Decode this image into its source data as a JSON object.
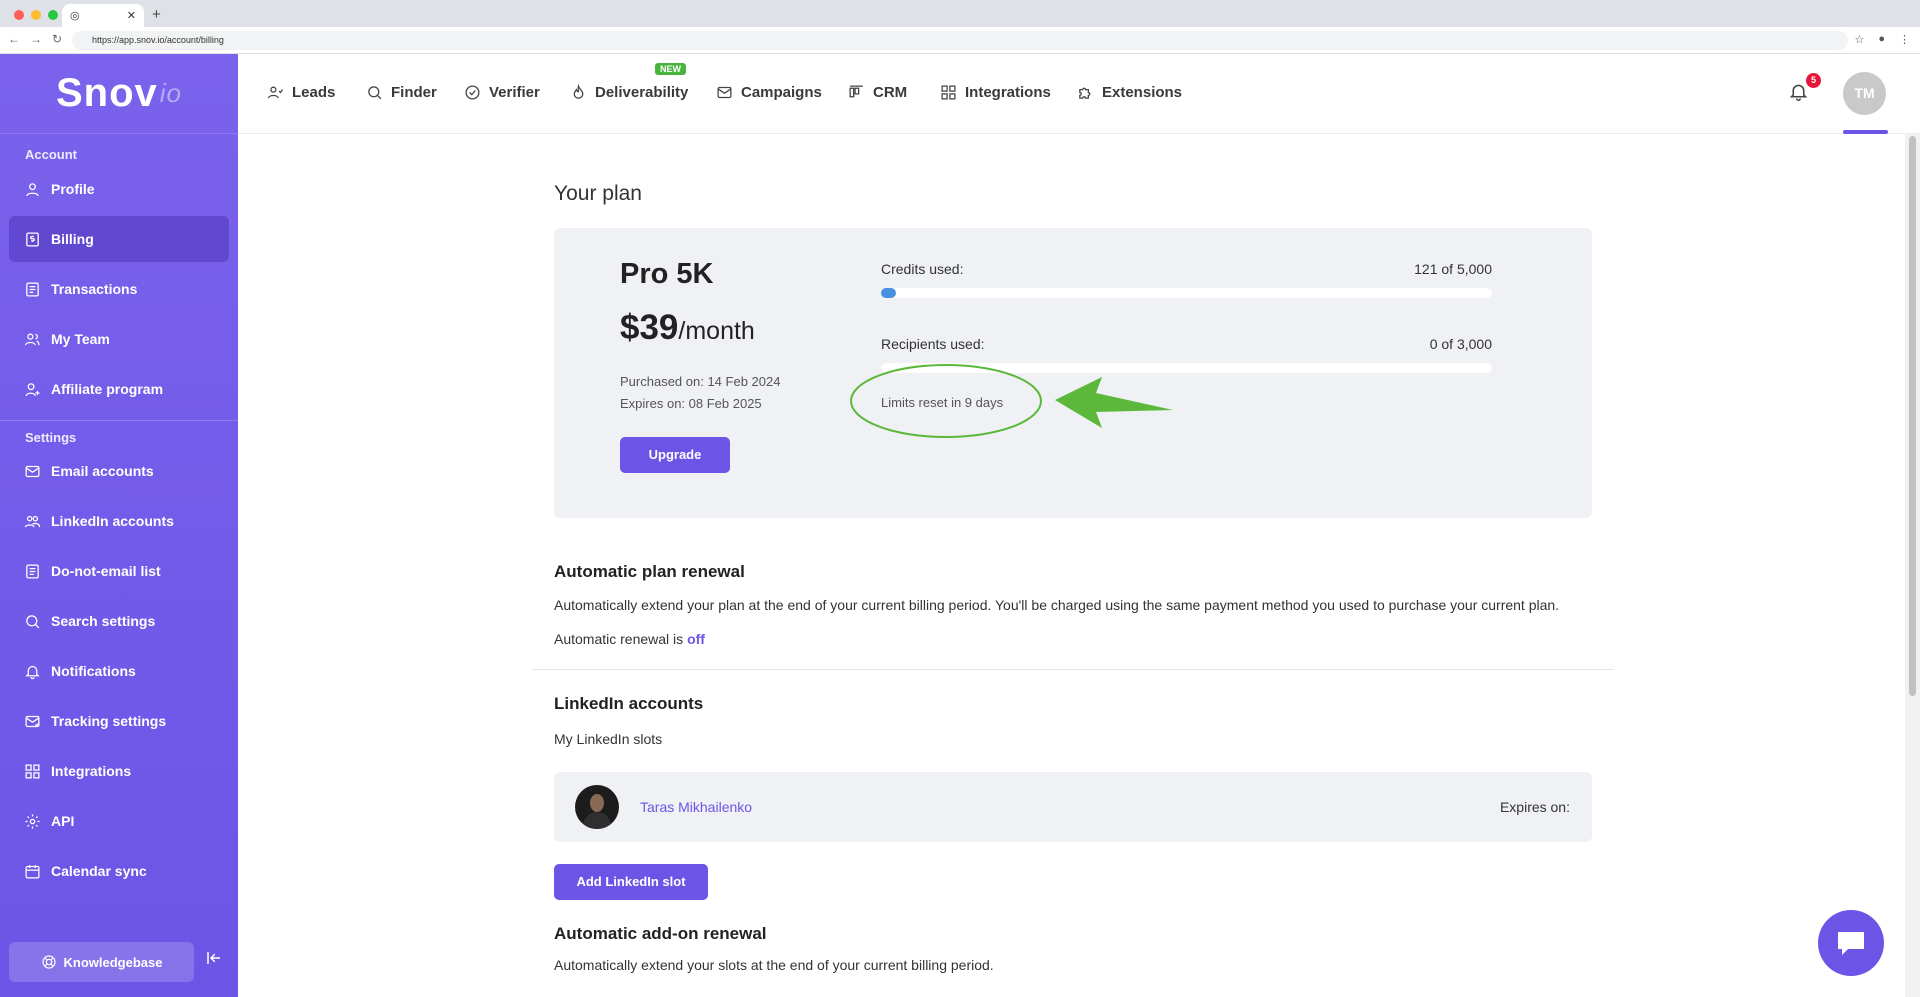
{
  "browser": {
    "tab_title": "",
    "url": "https://app.snov.io/account/billing"
  },
  "logo": {
    "main": "Snov",
    "suffix": "io"
  },
  "sidebar": {
    "section_account": "Account",
    "section_settings": "Settings",
    "items": [
      {
        "label": "Profile",
        "icon": "user-icon"
      },
      {
        "label": "Billing",
        "icon": "billing-icon",
        "active": true
      },
      {
        "label": "Transactions",
        "icon": "transactions-icon"
      },
      {
        "label": "My Team",
        "icon": "team-icon"
      },
      {
        "label": "Affiliate program",
        "icon": "affiliate-icon"
      },
      {
        "label": "Email accounts",
        "icon": "mail-icon"
      },
      {
        "label": "LinkedIn accounts",
        "icon": "linkedin-accounts-icon"
      },
      {
        "label": "Do-not-email list",
        "icon": "list-icon"
      },
      {
        "label": "Search settings",
        "icon": "search-icon"
      },
      {
        "label": "Notifications",
        "icon": "bell-icon"
      },
      {
        "label": "Tracking settings",
        "icon": "tracking-icon"
      },
      {
        "label": "Integrations",
        "icon": "grid-icon"
      },
      {
        "label": "API",
        "icon": "gear-icon"
      },
      {
        "label": "Calendar sync",
        "icon": "calendar-icon"
      }
    ],
    "knowledgebase": "Knowledgebase"
  },
  "topnav": {
    "items": [
      "Leads",
      "Finder",
      "Verifier",
      "Deliverability",
      "Campaigns",
      "CRM",
      "Integrations",
      "Extensions"
    ],
    "new_badge": "NEW",
    "notification_count": "5",
    "avatar_initials": "TM"
  },
  "plan": {
    "heading": "Your plan",
    "name": "Pro 5K",
    "price": "$39",
    "period": "/month",
    "purchased": "Purchased on: 14 Feb 2024",
    "expires": "Expires on: 08 Feb 2025",
    "upgrade": "Upgrade",
    "credits_label": "Credits used:",
    "credits_value": "121 of 5,000",
    "credits_fraction": 0.0242,
    "recipients_label": "Recipients used:",
    "recipients_value": "0 of 3,000",
    "recipients_fraction": 0,
    "reset": "Limits reset in 9 days"
  },
  "renewal": {
    "title": "Automatic plan renewal",
    "desc": "Automatically extend your plan at the end of your current billing period. You'll be charged using the same payment method you used to purchase your current plan.",
    "status_prefix": "Automatic renewal is",
    "status_value": "off"
  },
  "linkedin": {
    "title": "LinkedIn accounts",
    "subtitle": "My LinkedIn slots",
    "slot_name": "Taras Mikhailenko",
    "slot_expires": "Expires on:",
    "add_button": "Add LinkedIn slot"
  },
  "addon": {
    "title": "Automatic add-on renewal",
    "desc": "Automatically extend your slots at the end of your current billing period."
  },
  "colors": {
    "accent": "#6c55e6",
    "annotation": "#5cb83a",
    "progress": "#4a90e2"
  }
}
